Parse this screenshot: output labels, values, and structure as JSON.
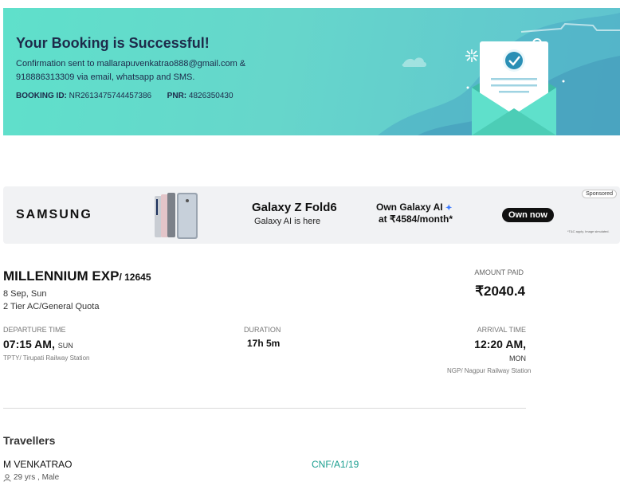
{
  "banner": {
    "title": "Your Booking is Successful!",
    "message": "Confirmation sent to mallarapuvenkatrao888@gmail.com & 918886313309 via email, whatsapp and SMS.",
    "booking_id_label": "BOOKING ID:",
    "booking_id": "NR2613475744457386",
    "pnr_label": "PNR:",
    "pnr": "4826350430",
    "colors": {
      "accent": "#5fe0cb",
      "text": "#1d2a4a"
    }
  },
  "ad": {
    "sponsored": "Sponsored",
    "brand": "SAMSUNG",
    "product": "Galaxy Z Fold6",
    "product_sub": "Galaxy AI is here",
    "offer_line1": "Own Galaxy AI",
    "offer_line2": "at ₹4584/month*",
    "cta": "Own now",
    "fine_print": "*T&C apply. Image simulated."
  },
  "train": {
    "name": "MILLENNIUM EXP",
    "number": "/ 12645",
    "date": "8 Sep, Sun",
    "class_quota": "2 Tier AC/General Quota",
    "amount_label": "AMOUNT PAID",
    "amount": "₹2040.4",
    "departure_label": "DEPARTURE TIME",
    "departure_time": "07:15 AM,",
    "departure_day": "SUN",
    "departure_station": "TPTY/ Tirupati Railway Station",
    "duration_label": "DURATION",
    "duration": "17h 5m",
    "arrival_label": "ARRIVAL TIME",
    "arrival_time": "12:20 AM,",
    "arrival_day": "MON",
    "arrival_station": "NGP/ Nagpur Railway Station"
  },
  "travellers": {
    "title": "Travellers",
    "list": [
      {
        "name": "M VENKATRAO",
        "meta": "29 yrs , Male",
        "status": "CNF/A1/19",
        "icon": "person-icon"
      }
    ],
    "colors": {
      "status": "#1a9e8f"
    }
  }
}
